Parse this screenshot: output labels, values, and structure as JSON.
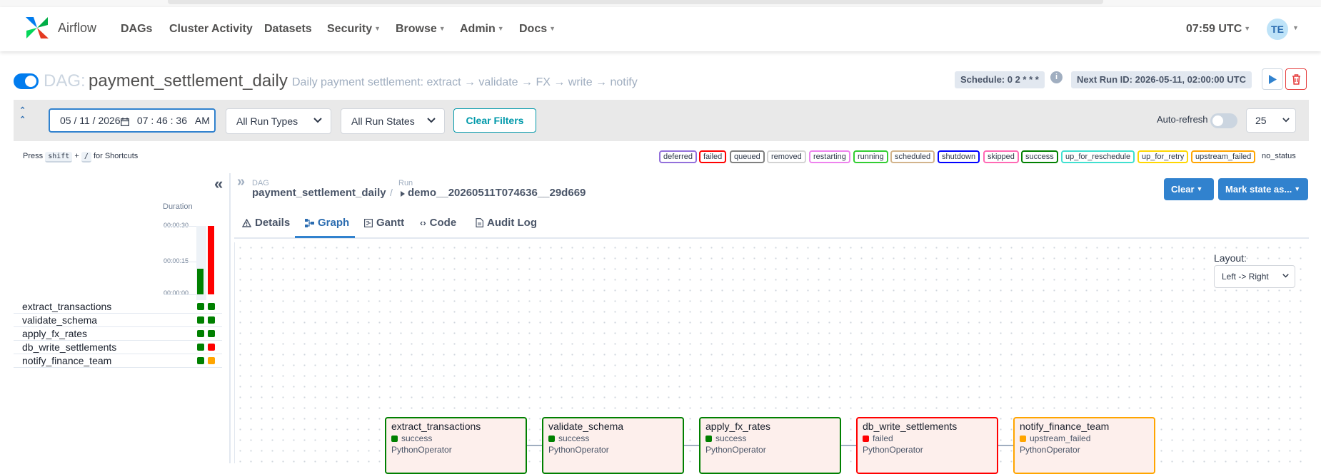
{
  "navbar": {
    "brand": "Airflow",
    "items": [
      "DAGs",
      "Cluster Activity",
      "Datasets",
      "Security",
      "Browse",
      "Admin",
      "Docs"
    ],
    "time": "07:59 UTC",
    "user_initials": "TE"
  },
  "dag": {
    "prefix": "DAG:",
    "id": "payment_settlement_daily",
    "description": "Daily payment settlement: extract → validate → FX → write → notify",
    "schedule": "Schedule: 0 2 * * *",
    "next_run": "Next Run ID: 2026-05-11, 02:00:00 UTC"
  },
  "filters": {
    "datetime": "05 / 11 / 2026      07 : 46 : 36   AM",
    "run_types": "All Run Types",
    "run_states": "All Run States",
    "clear_label": "Clear Filters",
    "auto_refresh_label": "Auto-refresh",
    "page_size": "25"
  },
  "shortcuts": {
    "press": "Press",
    "key1": "shift",
    "plus": "+",
    "key2": "/",
    "suffix": "for Shortcuts"
  },
  "legend": [
    {
      "label": "deferred",
      "color": "#9370db"
    },
    {
      "label": "failed",
      "color": "#ff0000"
    },
    {
      "label": "queued",
      "color": "#808080"
    },
    {
      "label": "removed",
      "color": "#d3d3d3"
    },
    {
      "label": "restarting",
      "color": "#ee82ee"
    },
    {
      "label": "running",
      "color": "#32cd32"
    },
    {
      "label": "scheduled",
      "color": "#d2b48c"
    },
    {
      "label": "shutdown",
      "color": "#0000ff"
    },
    {
      "label": "skipped",
      "color": "#ff69b4"
    },
    {
      "label": "success",
      "color": "#008000"
    },
    {
      "label": "up_for_reschedule",
      "color": "#40e0d0"
    },
    {
      "label": "up_for_retry",
      "color": "#ffd700"
    },
    {
      "label": "upstream_failed",
      "color": "#ffa500"
    },
    {
      "label": "no_status",
      "color": ""
    }
  ],
  "grid": {
    "duration_label": "Duration",
    "ticks": [
      "00:00:30",
      "00:00:15",
      "00:00:00"
    ],
    "tasks": [
      {
        "name": "extract_transactions",
        "state1": "#008000",
        "state2": "#008000"
      },
      {
        "name": "validate_schema",
        "state1": "#008000",
        "state2": "#008000"
      },
      {
        "name": "apply_fx_rates",
        "state1": "#008000",
        "state2": "#008000"
      },
      {
        "name": "db_write_settlements",
        "state1": "#008000",
        "state2": "#ff0000"
      },
      {
        "name": "notify_finance_team",
        "state1": "#008000",
        "state2": "#ffa500"
      }
    ]
  },
  "breadcrumb": {
    "dag_label": "DAG",
    "dag_value": "payment_settlement_daily",
    "separator": "/",
    "run_label": "Run",
    "run_value": "demo__20260511T074636__29d669"
  },
  "actions": {
    "clear": "Clear",
    "mark_state": "Mark state as..."
  },
  "tabs": [
    "Details",
    "Graph",
    "Gantt",
    "Code",
    "Audit Log"
  ],
  "graph": {
    "layout_label": "Layout:",
    "layout_value": "Left -> Right",
    "nodes": [
      {
        "name": "extract_transactions",
        "state": "success",
        "color": "#008000",
        "operator": "PythonOperator"
      },
      {
        "name": "validate_schema",
        "state": "success",
        "color": "#008000",
        "operator": "PythonOperator"
      },
      {
        "name": "apply_fx_rates",
        "state": "success",
        "color": "#008000",
        "operator": "PythonOperator"
      },
      {
        "name": "db_write_settlements",
        "state": "failed",
        "color": "#ff0000",
        "operator": "PythonOperator"
      },
      {
        "name": "notify_finance_team",
        "state": "upstream_failed",
        "color": "#ffa500",
        "operator": "PythonOperator"
      }
    ]
  }
}
